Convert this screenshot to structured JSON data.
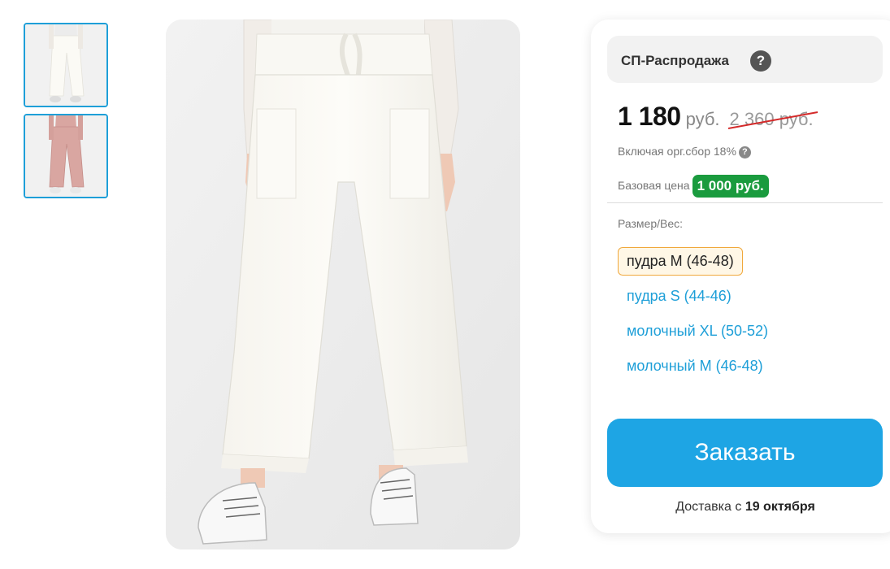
{
  "gallery": {
    "thumbnails": [
      {
        "alt": "white-pants",
        "color": "#f3f0ea"
      },
      {
        "alt": "pink-pants",
        "color": "#d9a6a1"
      }
    ]
  },
  "panel": {
    "sale_title": "СП-Распродажа",
    "help_icon": "?",
    "price": "1 180",
    "currency": "руб.",
    "old_price": "2 360 руб.",
    "fee_text": "Включая орг.сбор 18%",
    "base_price_label": "Базовая цена",
    "base_price_value": "1 000 руб.",
    "size_label": "Размер/Вес:",
    "sizes": [
      {
        "label": "пудра M (46-48)",
        "selected": true
      },
      {
        "label": "пудра S (44-46)",
        "selected": false
      },
      {
        "label": "молочный XL (50-52)",
        "selected": false
      },
      {
        "label": "молочный M (46-48)",
        "selected": false
      }
    ],
    "order_button": "Заказать",
    "delivery_prefix": "Доставка с",
    "delivery_date": "19 октября"
  },
  "colors": {
    "accent": "#1ea5e4",
    "badge_green": "#1a9b3e",
    "selected_border": "#f0a83c",
    "strike_red": "#d42a2a"
  }
}
